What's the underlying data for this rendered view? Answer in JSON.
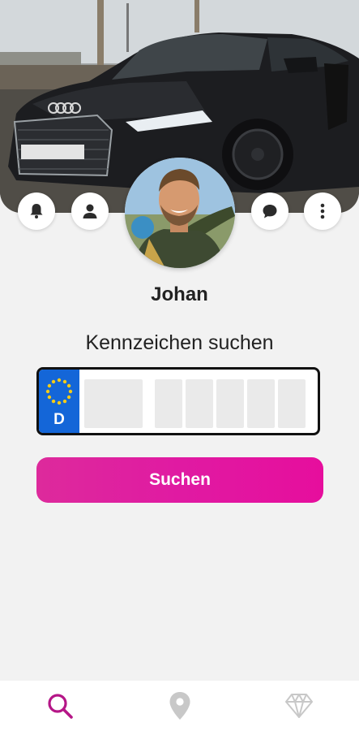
{
  "header": {
    "actions": {
      "notifications_icon": "bell-icon",
      "profile_icon": "person-icon",
      "chat_icon": "chat-bubble-icon",
      "more_icon": "more-vertical-icon"
    }
  },
  "profile": {
    "name": "Johan"
  },
  "search": {
    "title": "Kennzeichen suchen",
    "plate_country": "D",
    "button_label": "Suchen"
  },
  "bottom_nav": {
    "items": [
      {
        "icon": "search-icon",
        "active": true
      },
      {
        "icon": "location-pin-icon",
        "active": false
      },
      {
        "icon": "diamond-icon",
        "active": false
      }
    ]
  },
  "colors": {
    "accent": "#e01aa2",
    "accent_active_icon": "#b51687",
    "inactive_icon": "#c8c8c8",
    "plate_blue": "#1466d8",
    "eu_star_yellow": "#f5cc18"
  }
}
